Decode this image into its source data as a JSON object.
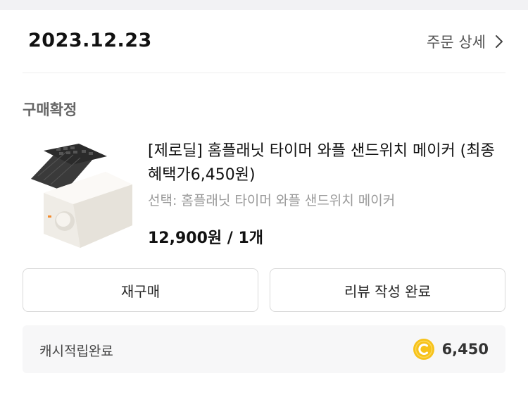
{
  "order": {
    "date": "2023.12.23",
    "detail_label": "주문 상세",
    "status": "구매확정"
  },
  "product": {
    "title": "[제로딜] 홈플래닛 타이머 와플 샌드위치 메이커 (최종혜택가6,450원)",
    "option": "선택: 홈플래닛 타이머 와플 샌드위치 메이커",
    "price_qty": "12,900원 / 1개"
  },
  "actions": {
    "rebuy_label": "재구매",
    "review_label": "리뷰 작성 완료"
  },
  "cashback": {
    "label": "캐시적립완료",
    "amount": "6,450",
    "coin_color": "#f7c21a"
  },
  "icons": {
    "detail": "chevron-right-icon",
    "coin": "coin-icon"
  }
}
